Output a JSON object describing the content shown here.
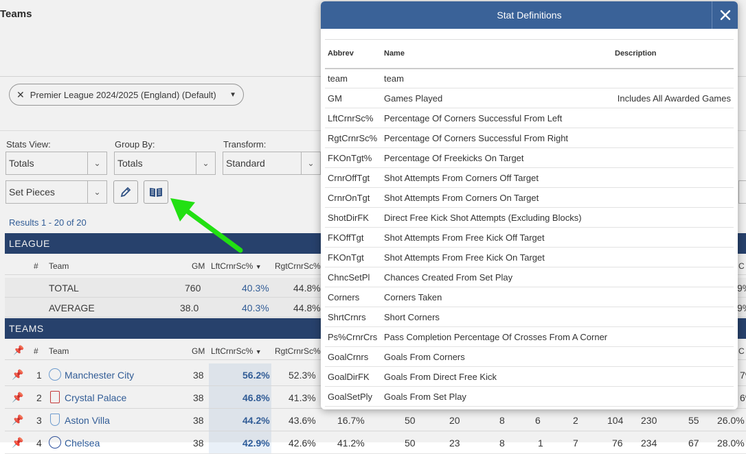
{
  "page": {
    "title": "Teams",
    "filter_chip": "Premier League 2024/2025 (England) (Default)",
    "controls": {
      "stats_view_label": "Stats View:",
      "stats_view_value": "Totals",
      "group_by_label": "Group By:",
      "group_by_value": "Totals",
      "transform_label": "Transform:",
      "transform_value": "Standard",
      "preset_value": "Set Pieces"
    },
    "results_text": "Results 1 - 20 of 20",
    "league_band": "LEAGUE",
    "teams_band": "TEAMS",
    "headers": {
      "num": "#",
      "team": "Team",
      "gm": "GM",
      "lft": "LftCrnrSc%",
      "rgt": "RgtCrnrSc%"
    },
    "league_rows": [
      {
        "team": "TOTAL",
        "gm": "760",
        "lft": "40.3%",
        "rgt": "44.8%",
        "frag": "9%"
      },
      {
        "team": "AVERAGE",
        "gm": "38.0",
        "lft": "40.3%",
        "rgt": "44.8%",
        "frag": "9%"
      }
    ],
    "team_rows": [
      {
        "rank": "1",
        "team": "Manchester City",
        "gm": "38",
        "lft": "56.2%",
        "rgt": "52.3%",
        "frag": "7%"
      },
      {
        "rank": "2",
        "team": "Crystal Palace",
        "gm": "38",
        "lft": "46.8%",
        "rgt": "41.3%",
        "frag": "6%"
      },
      {
        "rank": "3",
        "team": "Aston Villa",
        "gm": "38",
        "lft": "44.2%",
        "rgt": "43.6%",
        "extra": [
          "16.7%",
          "50",
          "20",
          "8",
          "6",
          "2",
          "104",
          "230",
          "55",
          "26.0%"
        ]
      },
      {
        "rank": "4",
        "team": "Chelsea",
        "gm": "38",
        "lft": "42.9%",
        "rgt": "42.6%",
        "extra": [
          "41.2%",
          "50",
          "23",
          "8",
          "1",
          "7",
          "76",
          "234",
          "67",
          "28.0%"
        ]
      }
    ],
    "header_frag": "C"
  },
  "modal": {
    "title": "Stat Definitions",
    "columns": {
      "abbrev": "Abbrev",
      "name": "Name",
      "description": "Description"
    },
    "rows": [
      {
        "abbrev": "team",
        "name": "team",
        "description": ""
      },
      {
        "abbrev": "GM",
        "name": "Games Played",
        "description": "Includes All Awarded Games"
      },
      {
        "abbrev": "LftCrnrSc%",
        "name": "Percentage Of Corners Successful From Left",
        "description": ""
      },
      {
        "abbrev": "RgtCrnrSc%",
        "name": "Percentage Of Corners Successful From Right",
        "description": ""
      },
      {
        "abbrev": "FKOnTgt%",
        "name": "Percentage Of Freekicks On Target",
        "description": ""
      },
      {
        "abbrev": "CrnrOffTgt",
        "name": "Shot Attempts From Corners Off Target",
        "description": ""
      },
      {
        "abbrev": "CrnrOnTgt",
        "name": "Shot Attempts From Corners On Target",
        "description": ""
      },
      {
        "abbrev": "ShotDirFK",
        "name": "Direct Free Kick Shot Attempts (Excluding Blocks)",
        "description": ""
      },
      {
        "abbrev": "FKOffTgt",
        "name": "Shot Attempts From Free Kick Off Target",
        "description": ""
      },
      {
        "abbrev": "FKOnTgt",
        "name": "Shot Attempts From Free Kick On Target",
        "description": ""
      },
      {
        "abbrev": "ChncSetPl",
        "name": "Chances Created From Set Play",
        "description": ""
      },
      {
        "abbrev": "Corners",
        "name": "Corners Taken",
        "description": ""
      },
      {
        "abbrev": "ShrtCrnrs",
        "name": "Short Corners",
        "description": ""
      },
      {
        "abbrev": "Ps%CrnrCrs",
        "name": "Pass Completion Percentage Of Crosses From A Corner",
        "description": ""
      },
      {
        "abbrev": "GoalCrnrs",
        "name": "Goals From Corners",
        "description": ""
      },
      {
        "abbrev": "GoalDirFK",
        "name": "Goals From Direct Free Kick",
        "description": ""
      },
      {
        "abbrev": "GoalSetPly",
        "name": "Goals From Set Play",
        "description": ""
      }
    ]
  },
  "colors": {
    "band": "#1f3b6b",
    "modal_header": "#3a6298",
    "arrow": "#22e012",
    "link": "#2a5a9a"
  },
  "icons": [
    "close-icon",
    "pencil-icon",
    "book-icon",
    "pin-icon",
    "chevron-down-icon",
    "team-crest-icon"
  ]
}
